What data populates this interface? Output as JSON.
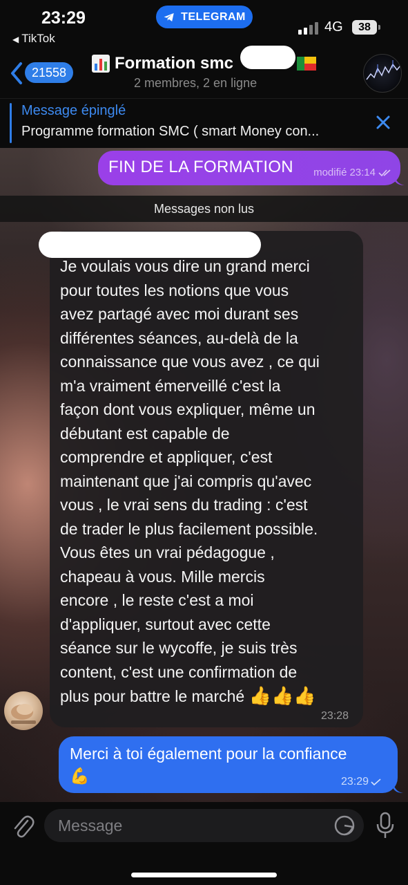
{
  "status_bar": {
    "time": "23:29",
    "back_app": "TikTok",
    "telegram_label": "TELEGRAM",
    "network": "4G",
    "battery": "38"
  },
  "header": {
    "unread_count": "21558",
    "chat_name": "Formation smc",
    "subtitle": "2 membres, 2 en ligne",
    "icons": [
      "chevron-left-icon",
      "bar-chart-icon",
      "benin-flag-icon",
      "group-avatar"
    ]
  },
  "pinned": {
    "title": "Message épinglé",
    "text": "Programme formation SMC ( smart Money con..."
  },
  "messages": {
    "outgoing_1": {
      "text": "FIN DE LA FORMATION",
      "edited": "modifié",
      "time": "23:14"
    },
    "unread_separator": "Messages non lus",
    "incoming_1": {
      "lines": [
        "Je voulais vous dire un grand merci",
        "pour toutes les notions que vous",
        "avez partagé avec moi durant ses",
        "différentes séances,  au-delà  de la",
        "connaissance que vous avez , ce qui",
        "m'a vraiment émerveillé c'est la",
        "façon dont vous expliquer, même un",
        "débutant est capable de",
        "comprendre et appliquer, c'est",
        "maintenant que j'ai compris qu'avec",
        "vous , le vrai sens du trading : c'est",
        "de trader le plus facilement possible.",
        "Vous êtes un vrai pédagogue ,",
        "chapeau à vous. Mille mercis",
        "encore , le reste c'est a moi",
        "d'appliquer, surtout avec cette",
        "séance sur le wycoffe, je suis très",
        "content, c'est une confirmation de",
        "plus pour battre le marché"
      ],
      "emoji": "👍👍👍",
      "time": "23:28"
    },
    "outgoing_2": {
      "text": "Merci à toi également pour la confiance",
      "emoji": "💪",
      "time": "23:29"
    }
  },
  "input": {
    "placeholder": "Message"
  },
  "colors": {
    "accent_blue": "#2f7ee8",
    "outgoing_purple": "#9a40e8",
    "outgoing_blue": "#2f6ff0",
    "incoming_dark": "#201e20"
  }
}
